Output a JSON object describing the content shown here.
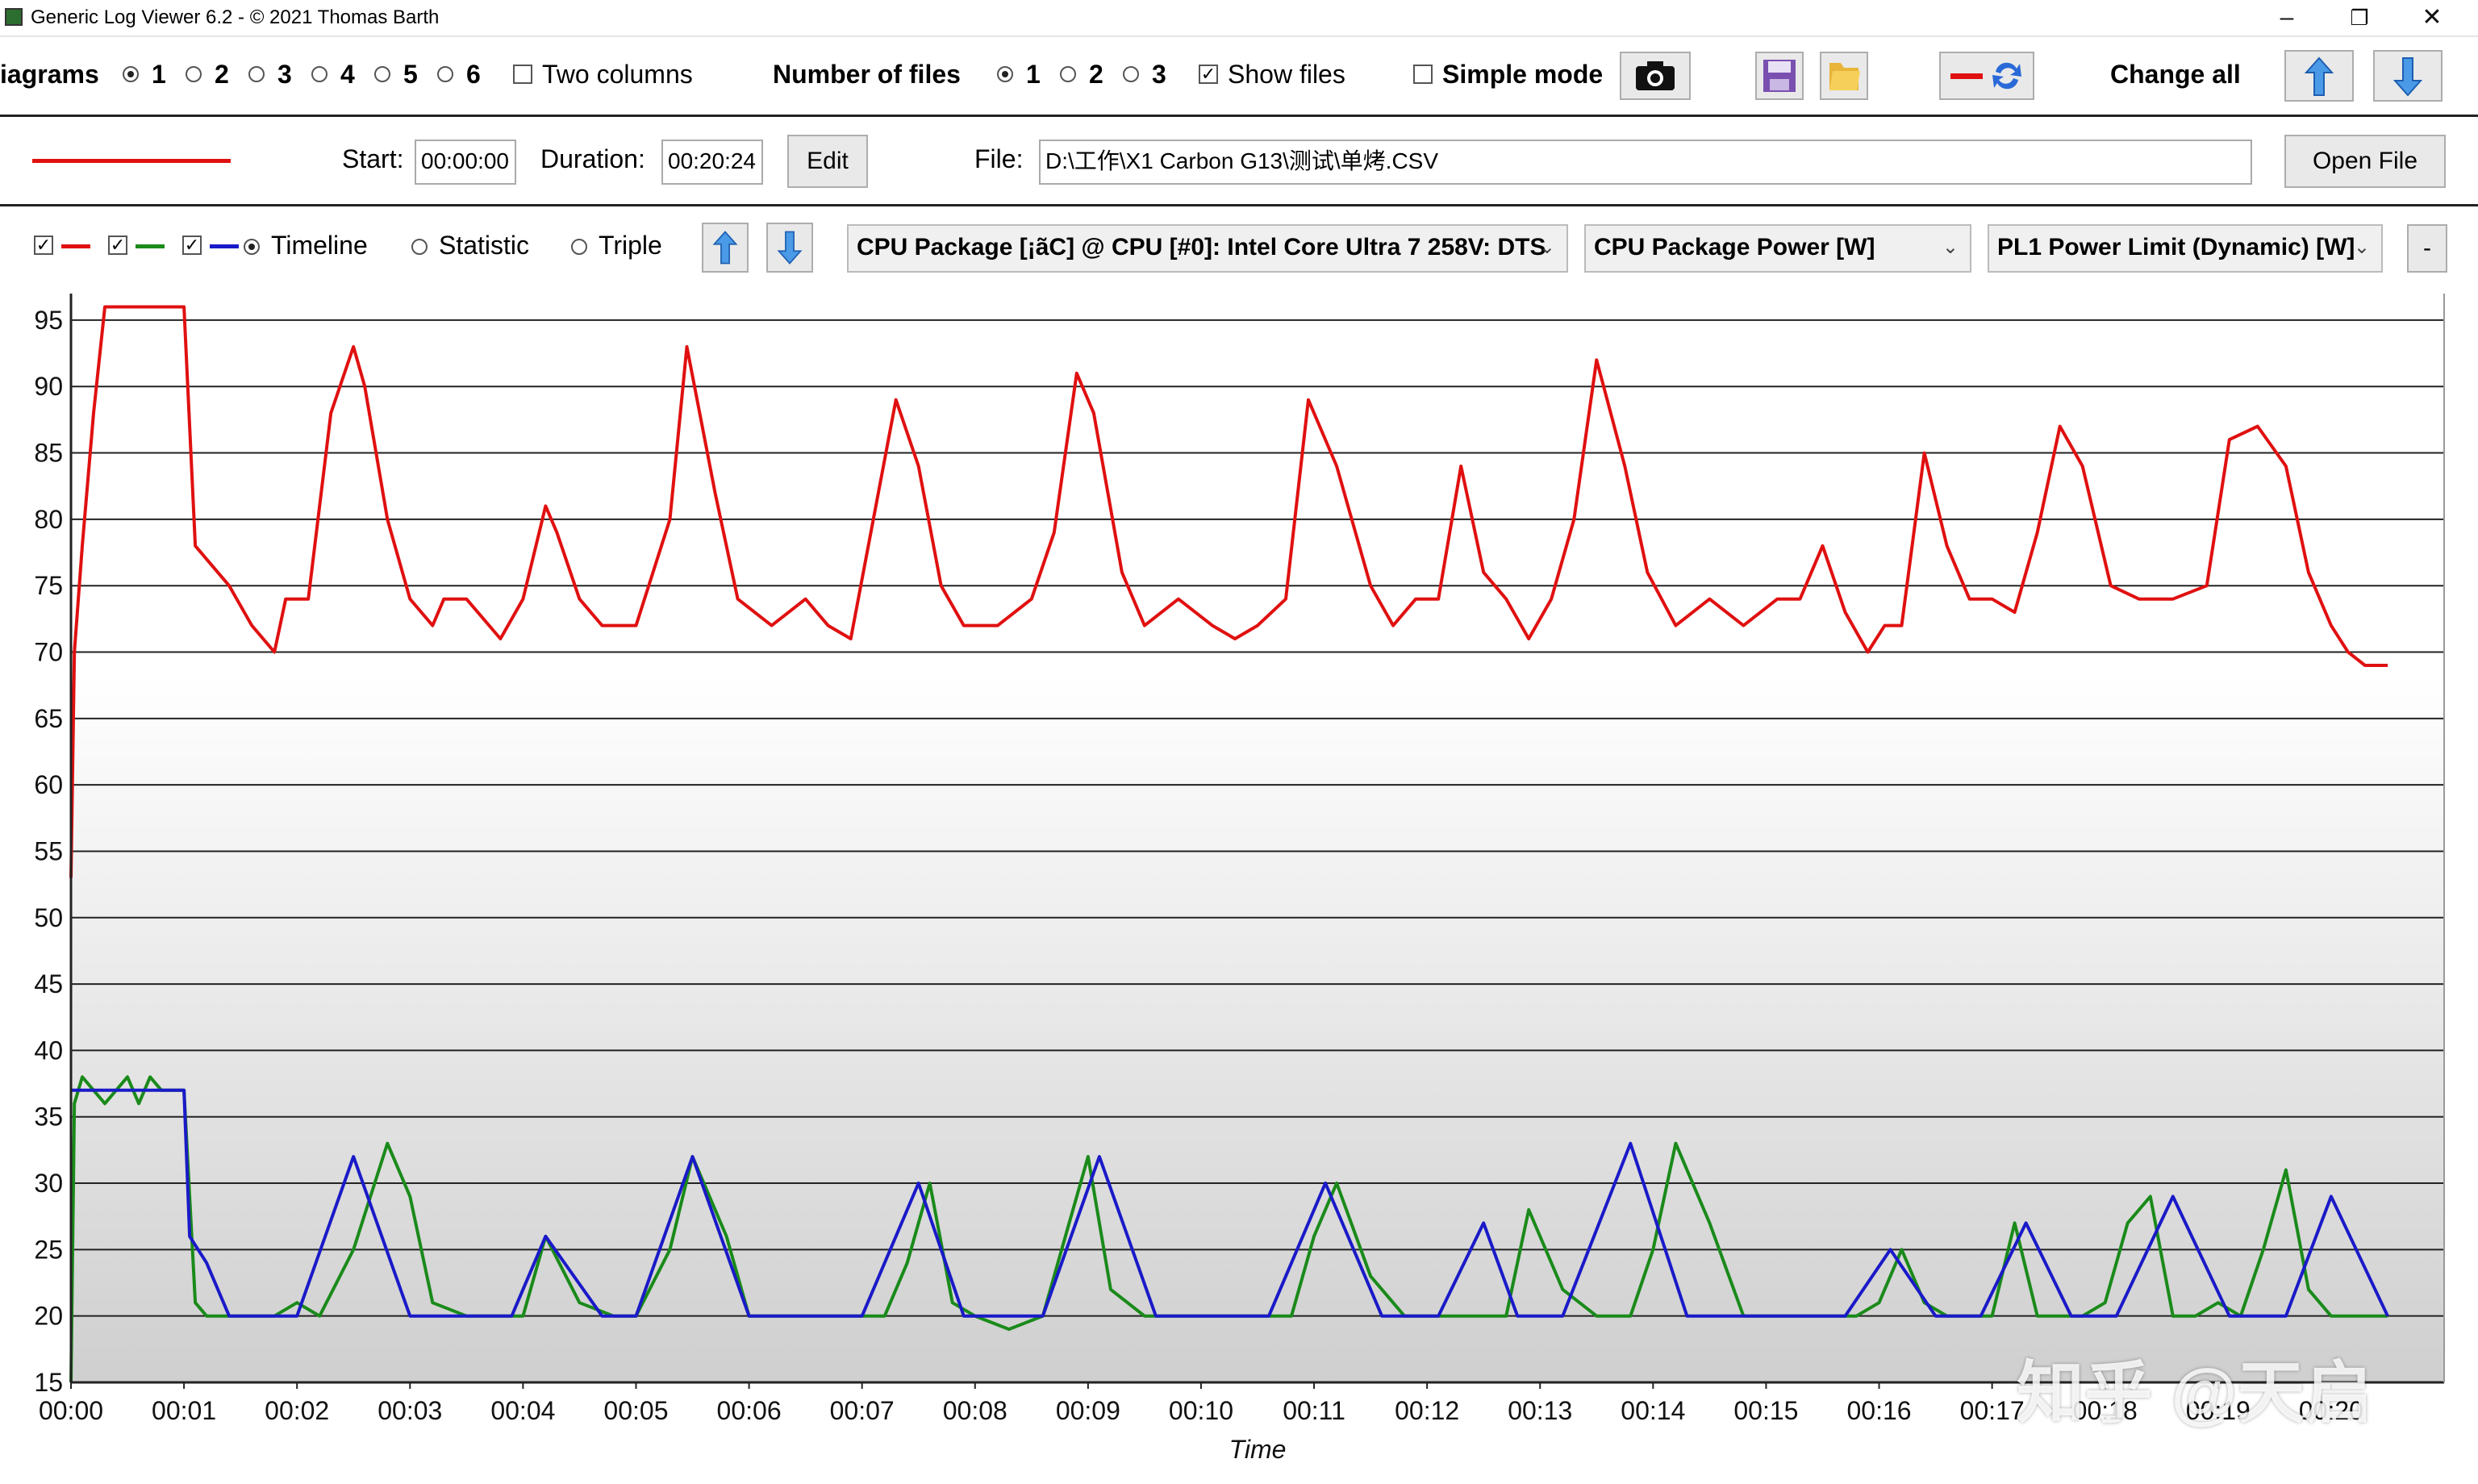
{
  "window": {
    "title": "Generic Log Viewer 6.2 - © 2021 Thomas Barth",
    "minimize": "–",
    "restore": "❐",
    "close": "✕"
  },
  "toolbar": {
    "diagrams_label": "iagrams",
    "diagram_options": [
      "1",
      "2",
      "3",
      "4",
      "5",
      "6"
    ],
    "diagram_selected": "1",
    "two_columns_label": "Two columns",
    "two_columns_checked": false,
    "number_of_files_label": "Number of files",
    "file_count_options": [
      "1",
      "2",
      "3"
    ],
    "file_count_selected": "1",
    "show_files_label": "Show files",
    "show_files_checked": true,
    "simple_mode_label": "Simple mode",
    "simple_mode_checked": false,
    "change_all_label": "Change all",
    "icons": [
      "camera-icon",
      "save-icon",
      "folder-icon",
      "swap-color-icon",
      "arrow-up-icon",
      "arrow-down-icon"
    ]
  },
  "file_row": {
    "line_color": "#e01010",
    "start_label": "Start:",
    "start_value": "00:00:00",
    "duration_label": "Duration:",
    "duration_value": "00:20:24",
    "edit_label": "Edit",
    "file_label": "File:",
    "file_path": "D:\\工作\\X1 Carbon G13\\测试\\单烤.CSV",
    "open_file_label": "Open File"
  },
  "diagram_row": {
    "series_checks": [
      {
        "checked": true,
        "color": "#e01010"
      },
      {
        "checked": true,
        "color": "#1a8a1a"
      },
      {
        "checked": true,
        "color": "#1a1ac8"
      }
    ],
    "modes": [
      "Timeline",
      "Statistic",
      "Triple"
    ],
    "mode_selected": "Timeline",
    "select_1": "CPU Package [¡ãC] @ CPU [#0]: Intel Core Ultra 7 258V: DTS",
    "select_2": "CPU Package Power [W]",
    "select_3": "PL1 Power Limit (Dynamic) [W]",
    "minus_label": "-"
  },
  "watermark": "知乎 @天启",
  "chart_data": {
    "type": "line",
    "xlabel": "Time",
    "ylabel": "",
    "ylim": [
      15,
      97
    ],
    "yticks": [
      15,
      20,
      25,
      30,
      35,
      40,
      45,
      50,
      55,
      60,
      65,
      70,
      75,
      80,
      85,
      90,
      95
    ],
    "xlim": [
      0,
      21
    ],
    "xtick_labels": [
      "00:00",
      "00:01",
      "00:02",
      "00:03",
      "00:04",
      "00:05",
      "00:06",
      "00:07",
      "00:08",
      "00:09",
      "00:10",
      "00:11",
      "00:12",
      "00:13",
      "00:14",
      "00:15",
      "00:16",
      "00:17",
      "00:18",
      "00:19",
      "00:20"
    ],
    "grid": true,
    "series": [
      {
        "color": "#e01010",
        "x": [
          0,
          0.03,
          0.1,
          0.2,
          0.3,
          0.4,
          0.6,
          0.8,
          1.0,
          1.1,
          1.2,
          1.4,
          1.6,
          1.8,
          1.9,
          2.1,
          2.3,
          2.5,
          2.6,
          2.8,
          3.0,
          3.2,
          3.3,
          3.5,
          3.8,
          4.0,
          4.2,
          4.3,
          4.5,
          4.7,
          5.0,
          5.3,
          5.45,
          5.7,
          5.9,
          6.2,
          6.5,
          6.7,
          6.9,
          7.1,
          7.3,
          7.5,
          7.7,
          7.9,
          8.2,
          8.5,
          8.7,
          8.9,
          9.05,
          9.3,
          9.5,
          9.8,
          10.1,
          10.3,
          10.5,
          10.75,
          10.95,
          11.2,
          11.5,
          11.7,
          11.9,
          12.1,
          12.3,
          12.5,
          12.7,
          12.9,
          13.1,
          13.3,
          13.5,
          13.75,
          13.95,
          14.2,
          14.5,
          14.8,
          15.1,
          15.3,
          15.5,
          15.7,
          15.9,
          16.05,
          16.2,
          16.4,
          16.6,
          16.8,
          17.0,
          17.2,
          17.4,
          17.6,
          17.8,
          18.05,
          18.3,
          18.6,
          18.9,
          19.1,
          19.35,
          19.6,
          19.8,
          20.0,
          20.15,
          20.3,
          20.5
        ],
        "y": [
          53,
          70,
          78,
          88,
          96,
          96,
          96,
          96,
          96,
          78,
          77,
          75,
          72,
          70,
          74,
          74,
          88,
          93,
          90,
          80,
          74,
          72,
          74,
          74,
          71,
          74,
          81,
          79,
          74,
          72,
          72,
          80,
          93,
          82,
          74,
          72,
          74,
          72,
          71,
          80,
          89,
          84,
          75,
          72,
          72,
          74,
          79,
          91,
          88,
          76,
          72,
          74,
          72,
          71,
          72,
          74,
          89,
          84,
          75,
          72,
          74,
          74,
          84,
          76,
          74,
          71,
          74,
          80,
          92,
          84,
          76,
          72,
          74,
          72,
          74,
          74,
          78,
          73,
          70,
          72,
          72,
          85,
          78,
          74,
          74,
          73,
          79,
          87,
          84,
          75,
          74,
          74,
          75,
          86,
          87,
          84,
          76,
          72,
          70,
          69,
          69
        ]
      },
      {
        "color": "#1a8a1a",
        "x": [
          0,
          0.03,
          0.1,
          0.2,
          0.3,
          0.4,
          0.5,
          0.6,
          0.7,
          0.8,
          0.9,
          1.0,
          1.1,
          1.2,
          1.4,
          1.6,
          1.8,
          2.0,
          2.2,
          2.5,
          2.8,
          3.0,
          3.2,
          3.5,
          3.8,
          4.0,
          4.2,
          4.5,
          4.8,
          5.0,
          5.3,
          5.5,
          5.8,
          6.0,
          6.2,
          6.5,
          6.8,
          7.0,
          7.2,
          7.4,
          7.6,
          7.8,
          8.0,
          8.3,
          8.6,
          8.8,
          9.0,
          9.2,
          9.5,
          9.8,
          10.0,
          10.3,
          10.6,
          10.8,
          11.0,
          11.2,
          11.5,
          11.8,
          12.1,
          12.4,
          12.7,
          12.9,
          13.2,
          13.5,
          13.8,
          14.0,
          14.2,
          14.5,
          14.8,
          15.1,
          15.4,
          15.6,
          15.8,
          16.0,
          16.2,
          16.4,
          16.6,
          16.8,
          17.0,
          17.2,
          17.4,
          17.6,
          17.8,
          18.0,
          18.2,
          18.4,
          18.6,
          18.8,
          19.0,
          19.2,
          19.4,
          19.6,
          19.8,
          20.0,
          20.2,
          20.4,
          20.5
        ],
        "y": [
          15,
          36,
          38,
          37,
          36,
          37,
          38,
          36,
          38,
          37,
          37,
          37,
          21,
          20,
          20,
          20,
          20,
          21,
          20,
          25,
          33,
          29,
          21,
          20,
          20,
          20,
          26,
          21,
          20,
          20,
          25,
          32,
          26,
          20,
          20,
          20,
          20,
          20,
          20,
          24,
          30,
          21,
          20,
          19,
          20,
          26,
          32,
          22,
          20,
          20,
          20,
          20,
          20,
          20,
          26,
          30,
          23,
          20,
          20,
          20,
          20,
          28,
          22,
          20,
          20,
          25,
          33,
          27,
          20,
          20,
          20,
          20,
          20,
          21,
          25,
          21,
          20,
          20,
          20,
          27,
          20,
          20,
          20,
          21,
          27,
          29,
          20,
          20,
          21,
          20,
          25,
          31,
          22,
          20,
          20,
          20,
          20
        ]
      },
      {
        "color": "#1a1ac8",
        "x": [
          0,
          0.03,
          0.5,
          0.97,
          1.0,
          1.05,
          1.2,
          1.4,
          2.0,
          2.5,
          3.0,
          3.9,
          4.2,
          4.7,
          5.0,
          5.5,
          6.0,
          7.0,
          7.5,
          7.9,
          8.0,
          8.6,
          9.1,
          9.6,
          10.0,
          10.6,
          11.1,
          11.6,
          12.1,
          12.5,
          12.8,
          13.2,
          13.8,
          14.3,
          14.9,
          15.7,
          16.1,
          16.5,
          16.9,
          17.3,
          17.7,
          18.1,
          18.6,
          19.1,
          19.6,
          20.0,
          20.5
        ],
        "y": [
          37,
          37,
          37,
          37,
          37,
          26,
          24,
          20,
          20,
          32,
          20,
          20,
          26,
          20,
          20,
          32,
          20,
          20,
          30,
          20,
          20,
          20,
          32,
          20,
          20,
          20,
          30,
          20,
          20,
          27,
          20,
          20,
          33,
          20,
          20,
          20,
          25,
          20,
          20,
          27,
          20,
          20,
          29,
          20,
          20,
          29,
          20
        ]
      }
    ]
  }
}
